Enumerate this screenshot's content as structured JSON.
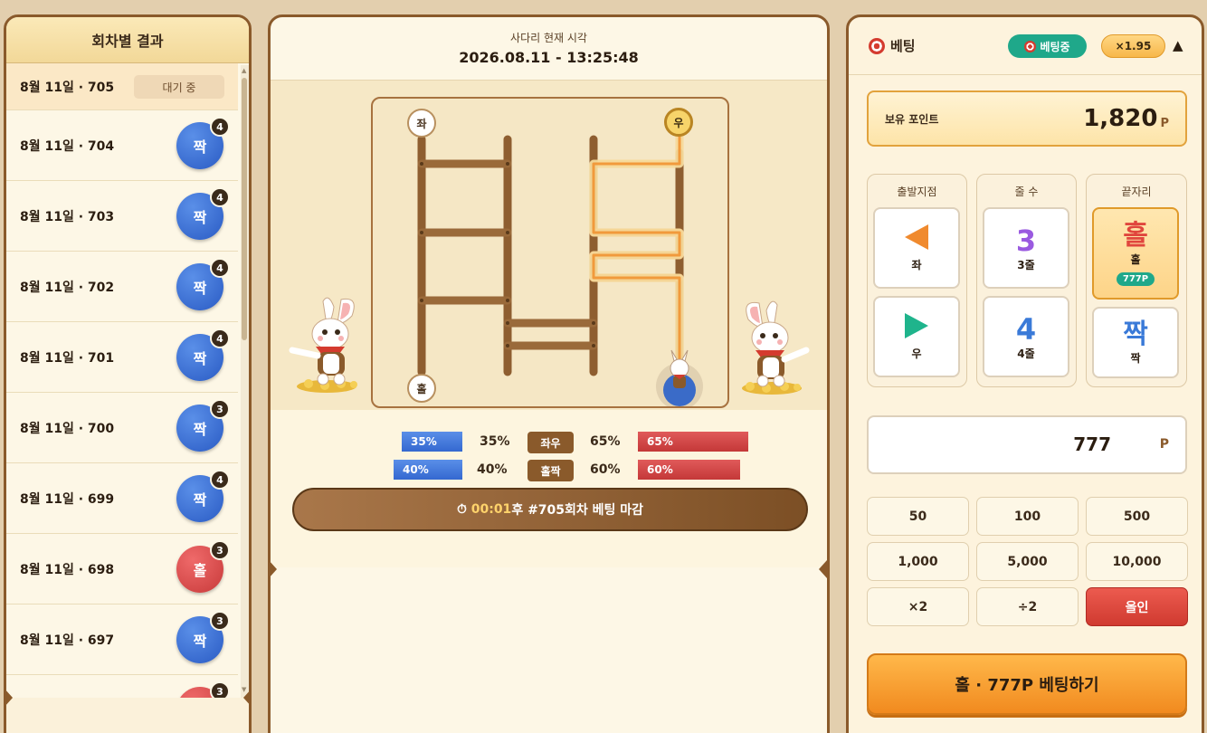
{
  "left_panel": {
    "title": "회차별 결과",
    "current": {
      "round": "8월 11일 · 705",
      "status": "대기 중"
    },
    "rows": [
      {
        "round": "8월 11일 · 704",
        "result": "짝",
        "count": "4",
        "color": "blue"
      },
      {
        "round": "8월 11일 · 703",
        "result": "짝",
        "count": "4",
        "color": "blue"
      },
      {
        "round": "8월 11일 · 702",
        "result": "짝",
        "count": "4",
        "color": "blue"
      },
      {
        "round": "8월 11일 · 701",
        "result": "짝",
        "count": "4",
        "color": "blue"
      },
      {
        "round": "8월 11일 · 700",
        "result": "짝",
        "count": "3",
        "color": "blue"
      },
      {
        "round": "8월 11일 · 699",
        "result": "짝",
        "count": "4",
        "color": "blue"
      },
      {
        "round": "8월 11일 · 698",
        "result": "홀",
        "count": "3",
        "color": "red"
      },
      {
        "round": "8월 11일 · 697",
        "result": "짝",
        "count": "3",
        "color": "blue"
      }
    ],
    "partial_count": "3"
  },
  "center_panel": {
    "clock_label": "사다리 현재 시각",
    "clock_value": "2026.08.11 - 13:25:48",
    "top_left": "좌",
    "top_right": "우",
    "bottom_left": "홀",
    "stats": {
      "lr": {
        "label": "좌우",
        "left_pct": "35%",
        "right_pct": "65%",
        "left": 0.35,
        "right": 0.65
      },
      "oe": {
        "label": "홀짝",
        "left_pct": "40%",
        "right_pct": "60%",
        "left": 0.4,
        "right": 0.6
      }
    },
    "timer": {
      "time": "00:01",
      "text": " 후 #705회차 베팅 마감"
    }
  },
  "right_panel": {
    "title": "베팅",
    "status_badge": "베팅중",
    "multiplier": "×1.95",
    "points_label": "보유 포인트",
    "points_value": "1,820",
    "points_unit": "P",
    "sections": {
      "start": {
        "title": "출발지점",
        "options": [
          {
            "label": "좌"
          },
          {
            "label": "우"
          }
        ]
      },
      "lines": {
        "title": "줄 수",
        "options": [
          {
            "big": "3",
            "label": "3줄"
          },
          {
            "big": "4",
            "label": "4줄"
          }
        ]
      },
      "end": {
        "title": "끝자리",
        "options": [
          {
            "big": "홀",
            "label": "홀",
            "tag": "777P"
          },
          {
            "big": "짝",
            "label": "짝"
          }
        ]
      }
    },
    "amount_value": "777",
    "amount_unit": "P",
    "chips": [
      "50",
      "100",
      "500",
      "1,000",
      "5,000",
      "10,000",
      "×2",
      "÷2",
      "올인"
    ],
    "bet_button": "홀 · 777P 베팅하기"
  },
  "colors": {
    "accent": "#f18a1f",
    "blue": "#2a5bc4",
    "red": "#c83a3a",
    "wood": "#8a5a2b",
    "teal": "#1fa88a"
  }
}
